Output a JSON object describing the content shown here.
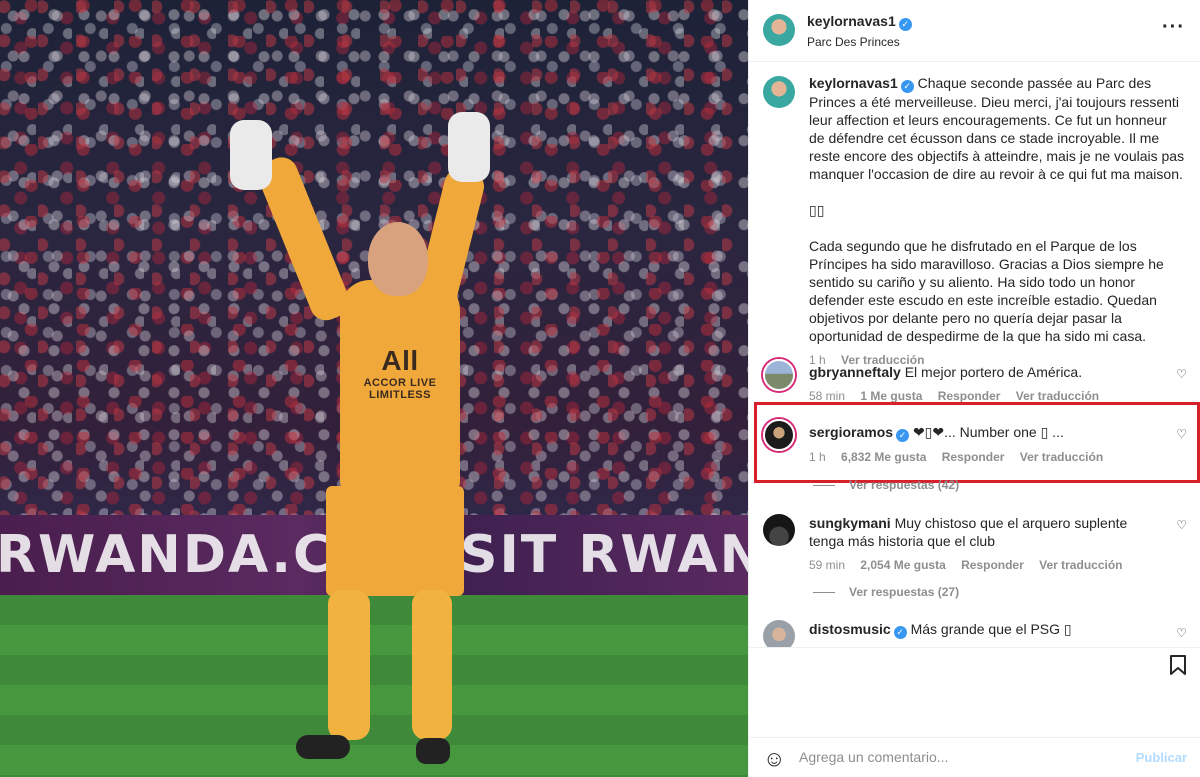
{
  "photo": {
    "banner_text_left": "RWANDA.COM",
    "banner_text_right": "SIT RWANDA",
    "sponsor_big": "All",
    "sponsor_small": "ACCOR LIVE LIMITLESS"
  },
  "header": {
    "username": "keylornavas1",
    "location": "Parc Des Princes",
    "more_icon": "more-horizontal-icon"
  },
  "caption": {
    "username": "keylornavas1",
    "text_fr": "Chaque seconde passée au Parc des Princes a été merveilleuse. Dieu merci, j'ai toujours ressenti leur affection et leurs encouragements. Ce fut un honneur de défendre cet écusson dans ce stade incroyable. Il me reste encore des objectifs à atteindre, mais je ne voulais pas manquer l'occasion de dire au revoir à ce qui fut ma maison.",
    "emoji_line": "▯▯",
    "text_es": "Cada segundo que he disfrutado en el Parque de los Príncipes ha sido maravilloso. Gracias a Dios siempre he sentido su cariño y su aliento. Ha sido todo un honor defender este escudo en este increíble estadio. Quedan objetivos por delante pero no quería dejar pasar la oportunidad de despedirme de la que ha sido mi casa.",
    "time": "1 h",
    "translate": "Ver traducción"
  },
  "comments": [
    {
      "username": "gbryanneftaly",
      "text": "El mejor portero de América.",
      "time": "58 min",
      "likes": "1 Me gusta",
      "reply": "Responder",
      "translate": "Ver traducción"
    },
    {
      "username": "sergioramos",
      "text": "❤▯❤... Number one ▯ ...",
      "time": "1 h",
      "likes": "6,832 Me gusta",
      "reply": "Responder",
      "translate": "Ver traducción",
      "replies": "Ver respuestas (42)"
    },
    {
      "username": "sungkymani",
      "text": "Muy chistoso que el arquero suplente tenga más historia que el club",
      "time": "59 min",
      "likes": "2,054 Me gusta",
      "reply": "Responder",
      "translate": "Ver traducción",
      "replies": "Ver respuestas (27)"
    },
    {
      "username": "distosmusic",
      "text": "Más grande que el PSG ▯"
    }
  ],
  "add_comment": {
    "placeholder": "Agrega un comentario...",
    "post_label": "Publicar"
  },
  "colors": {
    "highlight": "#d8202a",
    "verified": "#3897f0",
    "post_disabled": "#b3dbff"
  }
}
